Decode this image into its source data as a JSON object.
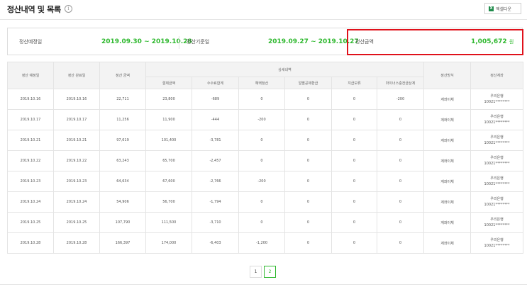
{
  "header": {
    "title": "정산내역 및 목록",
    "excel_label": "엑셀다운"
  },
  "summary": {
    "scheduled_label": "정산예정일",
    "scheduled_range": "2019.09.30 ~ 2019.10.28",
    "base_label": "정산기준일",
    "base_range": "2019.09.27 ~ 2019.10.27",
    "amount_label": "정산금액",
    "amount_value": "1,005,672",
    "amount_unit": "원"
  },
  "table": {
    "headers": {
      "scheduled_date": "정산 예정일",
      "completed_date": "정산 완료일",
      "settlement_amount": "정산 금액",
      "details_group": "상세내역",
      "settlement_method": "정산방식",
      "settlement_account": "정산계좌"
    },
    "sub_headers": [
      "결제금액",
      "수수료합계",
      "혜택정산",
      "일별공제환급",
      "지급보류",
      "마이너스충전금상계"
    ],
    "rows": [
      {
        "scheduled": "2019.10.16",
        "completed": "2019.10.16",
        "amount": "22,711",
        "payment": "23,800",
        "fee": "-689",
        "benefit": "0",
        "deduction": "0",
        "hold": "0",
        "minus": "-200",
        "method": "계좌이체",
        "bank": "우리은행",
        "account": "10021********"
      },
      {
        "scheduled": "2019.10.17",
        "completed": "2019.10.17",
        "amount": "11,256",
        "payment": "11,900",
        "fee": "-444",
        "benefit": "-200",
        "deduction": "0",
        "hold": "0",
        "minus": "0",
        "method": "계좌이체",
        "bank": "우리은행",
        "account": "10021********"
      },
      {
        "scheduled": "2019.10.21",
        "completed": "2019.10.21",
        "amount": "97,619",
        "payment": "101,400",
        "fee": "-3,781",
        "benefit": "0",
        "deduction": "0",
        "hold": "0",
        "minus": "0",
        "method": "계좌이체",
        "bank": "우리은행",
        "account": "10021********"
      },
      {
        "scheduled": "2019.10.22",
        "completed": "2019.10.22",
        "amount": "63,243",
        "payment": "65,700",
        "fee": "-2,457",
        "benefit": "0",
        "deduction": "0",
        "hold": "0",
        "minus": "0",
        "method": "계좌이체",
        "bank": "우리은행",
        "account": "10021********"
      },
      {
        "scheduled": "2019.10.23",
        "completed": "2019.10.23",
        "amount": "64,634",
        "payment": "67,600",
        "fee": "-2,766",
        "benefit": "-200",
        "deduction": "0",
        "hold": "0",
        "minus": "0",
        "method": "계좌이체",
        "bank": "우리은행",
        "account": "10021********"
      },
      {
        "scheduled": "2019.10.24",
        "completed": "2019.10.24",
        "amount": "54,906",
        "payment": "56,700",
        "fee": "-1,794",
        "benefit": "0",
        "deduction": "0",
        "hold": "0",
        "minus": "0",
        "method": "계좌이체",
        "bank": "우리은행",
        "account": "10021********"
      },
      {
        "scheduled": "2019.10.25",
        "completed": "2019.10.25",
        "amount": "107,790",
        "payment": "111,500",
        "fee": "-3,710",
        "benefit": "0",
        "deduction": "0",
        "hold": "0",
        "minus": "0",
        "method": "계좌이체",
        "bank": "우리은행",
        "account": "10021********"
      },
      {
        "scheduled": "2019.10.28",
        "completed": "2019.10.28",
        "amount": "166,397",
        "payment": "174,000",
        "fee": "-6,403",
        "benefit": "-1,200",
        "deduction": "0",
        "hold": "0",
        "minus": "0",
        "method": "계좌이체",
        "bank": "우리은행",
        "account": "10021********"
      }
    ]
  },
  "pagination": {
    "pages": [
      "1",
      "2"
    ],
    "active": "2"
  },
  "colors": {
    "accent_green": "#2eb82e",
    "highlight_red": "#e0111b",
    "blue_value": "#1b3fd6",
    "red_value": "#e02424"
  },
  "icons": {
    "info": "info-icon",
    "excel": "excel-icon"
  }
}
